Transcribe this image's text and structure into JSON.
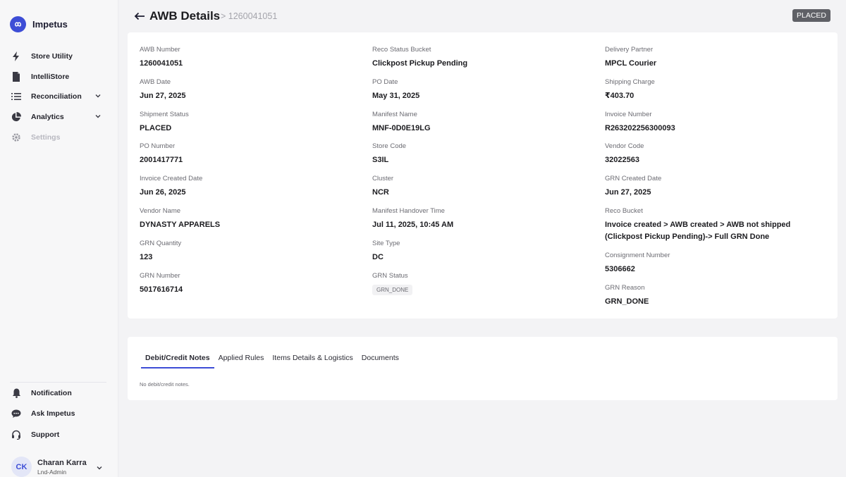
{
  "brand": {
    "name": "Impetus"
  },
  "sidebar": {
    "items": [
      {
        "label": "Store Utility",
        "icon": "bolt-icon"
      },
      {
        "label": "IntelliStore",
        "icon": "document-icon"
      },
      {
        "label": "Reconciliation",
        "icon": "list-icon"
      },
      {
        "label": "Analytics",
        "icon": "pie-chart-icon"
      },
      {
        "label": "Settings",
        "icon": "gear-icon"
      }
    ],
    "bottom_items": [
      {
        "label": "Notification",
        "icon": "bell-icon"
      },
      {
        "label": "Ask Impetus",
        "icon": "chat-icon"
      },
      {
        "label": "Support",
        "icon": "headset-icon"
      }
    ],
    "user": {
      "initials": "CK",
      "name": "Charan Karra",
      "role": "Lnd-Admin"
    }
  },
  "header": {
    "title": "AWB Details",
    "breadcrumb": "> 1260041051",
    "status": "PLACED"
  },
  "details": {
    "col1": [
      {
        "label": "AWB Number",
        "value": "1260041051"
      },
      {
        "label": "AWB Date",
        "value": "Jun 27, 2025"
      },
      {
        "label": "Shipment Status",
        "value": "PLACED"
      },
      {
        "label": "PO Number",
        "value": "2001417771"
      },
      {
        "label": "Invoice Created Date",
        "value": "Jun 26, 2025"
      },
      {
        "label": "Vendor Name",
        "value": "DYNASTY APPARELS"
      },
      {
        "label": "GRN Quantity",
        "value": "123"
      },
      {
        "label": "GRN Number",
        "value": "5017616714"
      }
    ],
    "col2": [
      {
        "label": "Reco Status Bucket",
        "value": "Clickpost Pickup Pending"
      },
      {
        "label": "PO Date",
        "value": "May 31, 2025"
      },
      {
        "label": "Manifest Name",
        "value": "MNF-0D0E19LG"
      },
      {
        "label": "Store Code",
        "value": "S3IL"
      },
      {
        "label": "Cluster",
        "value": "NCR"
      },
      {
        "label": "Manifest Handover Time",
        "value": "Jul 11, 2025, 10:45 AM"
      },
      {
        "label": "Site Type",
        "value": "DC"
      },
      {
        "label": "GRN Status",
        "value": "GRN_DONE"
      }
    ],
    "col3": [
      {
        "label": "Delivery Partner",
        "value": "MPCL Courier"
      },
      {
        "label": "Shipping Charge",
        "value": "₹403.70"
      },
      {
        "label": "Invoice Number",
        "value": "R263202256300093"
      },
      {
        "label": "Vendor Code",
        "value": "32022563"
      },
      {
        "label": "GRN Created Date",
        "value": "Jun 27, 2025"
      },
      {
        "label": "Reco Bucket",
        "value": "Invoice created > AWB created > AWB not shipped (Clickpost Pickup Pending)-> Full GRN Done"
      },
      {
        "label": "Consignment Number",
        "value": "5306662"
      },
      {
        "label": "GRN Reason",
        "value": "GRN_DONE"
      }
    ]
  },
  "tabs": {
    "items": [
      "Debit/Credit Notes",
      "Applied Rules",
      "Items Details & Logistics",
      "Documents"
    ],
    "empty_message": "No debit/credit notes."
  },
  "colors": {
    "accent": "#3d4dd6",
    "status_pill": "#5f6066"
  }
}
